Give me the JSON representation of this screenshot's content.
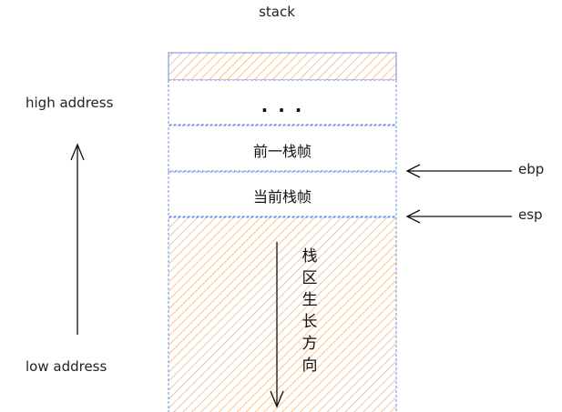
{
  "title": "stack",
  "labels": {
    "high_address": "high address",
    "low_address": "low address",
    "ebp": "ebp",
    "esp": "esp"
  },
  "frames": {
    "ellipsis": ". . .",
    "previous_frame": "前一栈帧",
    "current_frame": "当前栈帧"
  },
  "growth_text": "栈区生长方向",
  "colors": {
    "hatch": "#f4a45a",
    "frame_border": "#6b8ee8",
    "ink": "#111111"
  }
}
